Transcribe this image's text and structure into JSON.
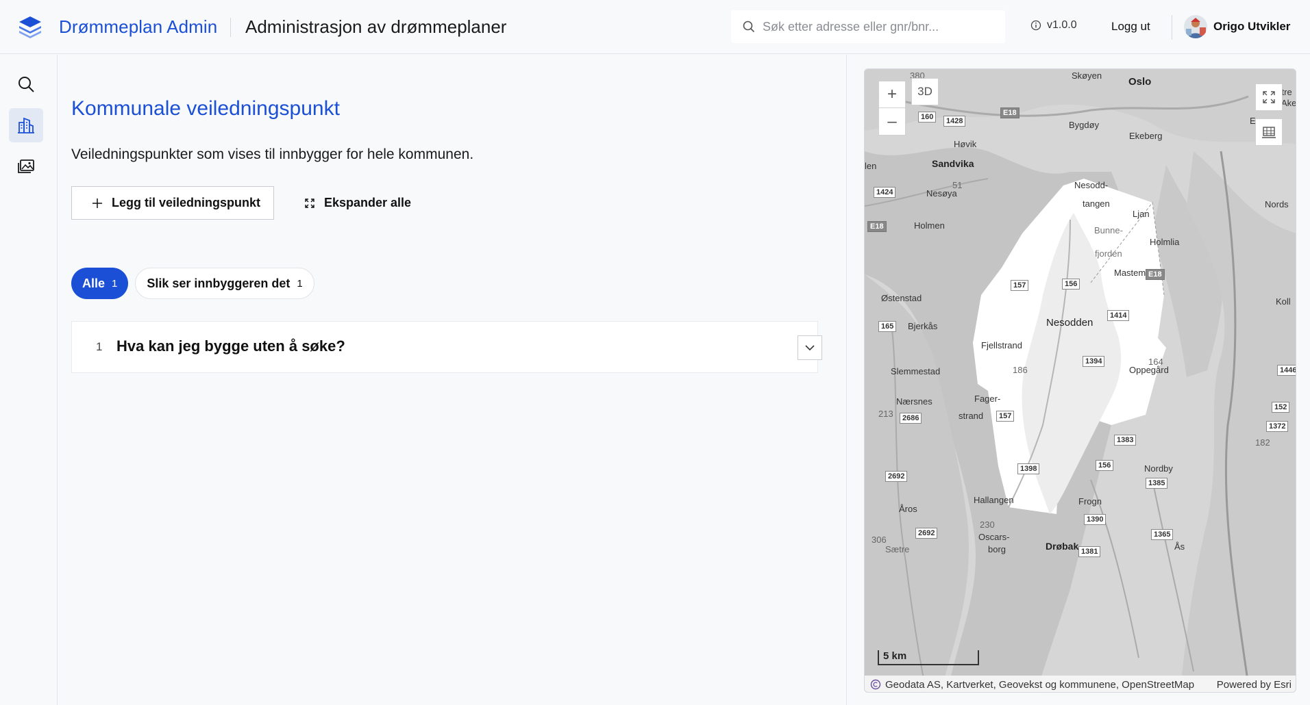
{
  "header": {
    "brand": "Drømmeplan Admin",
    "title": "Administrasjon av drømmeplaner",
    "search_placeholder": "Søk etter adresse eller gnr/bnr...",
    "version": "v1.0.0",
    "logout_label": "Logg ut",
    "username": "Origo Utvikler"
  },
  "rail": {
    "items": [
      {
        "icon": "search-icon"
      },
      {
        "icon": "building-icon",
        "active": true
      },
      {
        "icon": "gallery-icon"
      }
    ]
  },
  "main": {
    "title": "Kommunale veiledningspunkt",
    "description": "Veiledningspunkter som vises til innbygger for hele kommunen.",
    "add_button": "Legg til veiledningspunkt",
    "expand_button": "Ekspander alle",
    "filters": [
      {
        "label": "Alle",
        "count": "1",
        "active": true
      },
      {
        "label": "Slik ser innbyggeren det",
        "count": "1",
        "active": false
      }
    ],
    "items": [
      {
        "number": "1",
        "title": "Hva kan jeg bygge uten å søke?"
      }
    ]
  },
  "map": {
    "btn_3d": "3D",
    "zoom_in": "+",
    "zoom_out": "–",
    "scale_label": "5 km",
    "attribution": "Geodata AS, Kartverket, Geovekst og kommunene, OpenStreetMap",
    "powered_by": "Powered by Esri",
    "labels": {
      "skoyen": "Skøyen",
      "oslo": "Oslo",
      "bygdoy": "Bygdøy",
      "ekeberg": "Ekeberg",
      "hovik": "Høvik",
      "sandvika": "Sandvika",
      "nesoya": "Nesøya",
      "nesodd": "Nesodd-",
      "tangen": "tangen",
      "ljan": "Ljan",
      "holmen": "Holmen",
      "bunne": "Bunne-",
      "fjorden": "fjorden",
      "holmlia": "Holmlia",
      "mastemyr": "Mastemyr",
      "ostenstad": "Østenstad",
      "nesodden": "Nesodden",
      "bjerkas": "Bjerkås",
      "fjellstrand": "Fjellstrand",
      "slemmestad": "Slemmestad",
      "oppegard": "Oppegård",
      "fager": "Fager-",
      "strand": "strand",
      "naersnes": "Nærsnes",
      "nordby": "Nordby",
      "hallangen": "Hallangen",
      "frogn": "Frogn",
      "aros": "Åros",
      "oscars": "Oscars-",
      "borg": "borg",
      "drobak": "Drøbak",
      "as": "Ås",
      "len": "len",
      "nords": "Nords",
      "koll": "Koll",
      "stre": "stre",
      "ake": "Ake",
      "e": "E",
      "n380": "380",
      "n51": "51",
      "n186": "186",
      "n164": "164",
      "n213": "213",
      "n182": "182",
      "n230": "230",
      "n306": "306",
      "saetre": "Sætre"
    },
    "shields": {
      "s160": "160",
      "s1428": "1428",
      "e18a": "E18",
      "s1424": "1424",
      "e18b": "E18",
      "s157a": "157",
      "s156a": "156",
      "e18c": "E18",
      "s1414": "1414",
      "s165": "165",
      "s1394": "1394",
      "s2686": "2686",
      "s157b": "157",
      "s152": "152",
      "s1372": "1372",
      "s1383": "1383",
      "s1398": "1398",
      "s156b": "156",
      "s1385": "1385",
      "s2692a": "2692",
      "s1390": "1390",
      "s2692b": "2692",
      "s1365": "1365",
      "s1381": "1381",
      "s1446": "1446"
    }
  }
}
